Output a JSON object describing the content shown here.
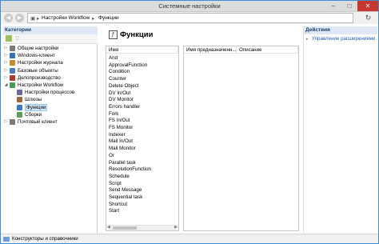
{
  "window": {
    "title": "Системные настройки"
  },
  "address": {
    "crumbs": [
      "Настройки Workflow",
      "Функции"
    ]
  },
  "categories_panel": {
    "header": "Категории",
    "tree": [
      {
        "label": "Общие настройки",
        "expander": "▷",
        "icon": "settings-icon",
        "color": "#7a7a7a"
      },
      {
        "label": "Windows-клиент",
        "expander": "▷",
        "icon": "computer-icon",
        "color": "#3a6fb0"
      },
      {
        "label": "Настройки журнала",
        "expander": "▷",
        "icon": "journal-icon",
        "color": "#c98a2e"
      },
      {
        "label": "Базовые объекты",
        "expander": "▷",
        "icon": "objects-icon",
        "color": "#4a7dbf"
      },
      {
        "label": "Делопроизводство",
        "expander": "▷",
        "icon": "records-icon",
        "color": "#b03a2e"
      },
      {
        "label": "Настройки Workflow",
        "expander": "◢",
        "icon": "workflow-icon",
        "color": "#4a9a5a"
      },
      {
        "label": "Настройки процессов",
        "expander": "",
        "icon": "process-icon",
        "color": "#6a6a9a"
      },
      {
        "label": "Шлюзы",
        "expander": "",
        "icon": "gateway-icon",
        "color": "#9a6a3a"
      },
      {
        "label": "Функции",
        "expander": "",
        "icon": "function-icon",
        "color": "#3a7ac4",
        "selected": true
      },
      {
        "label": "Сборки",
        "expander": "",
        "icon": "assembly-icon",
        "color": "#5aa05a"
      },
      {
        "label": "Почтовый клиент",
        "expander": "▷",
        "icon": "mail-icon",
        "color": "#7a7a7a"
      }
    ]
  },
  "main": {
    "title": "Функции",
    "list_left": {
      "header": "Имя",
      "items": [
        "And",
        "ApprovalFunction",
        "Condition",
        "Counter",
        "Delete Object",
        "DV In/Out",
        "DV Monitor",
        "Errors handler",
        "Fork",
        "FS In/Out",
        "FS Monitor",
        "Indexer",
        "Mail In/Out",
        "Mail Monitor",
        "Or",
        "Parallel task",
        "ResolutionFunction",
        "Schedule",
        "Script",
        "Send Message",
        "Sequential task",
        "Shortcut",
        "Start"
      ]
    },
    "list_right": {
      "headers": [
        "Имя предназначенн...",
        "Описание"
      ]
    }
  },
  "actions_panel": {
    "header": "Действия",
    "items": [
      "Управление расширениями"
    ]
  },
  "statusbar": {
    "text": "Конструкторы и справочники"
  }
}
